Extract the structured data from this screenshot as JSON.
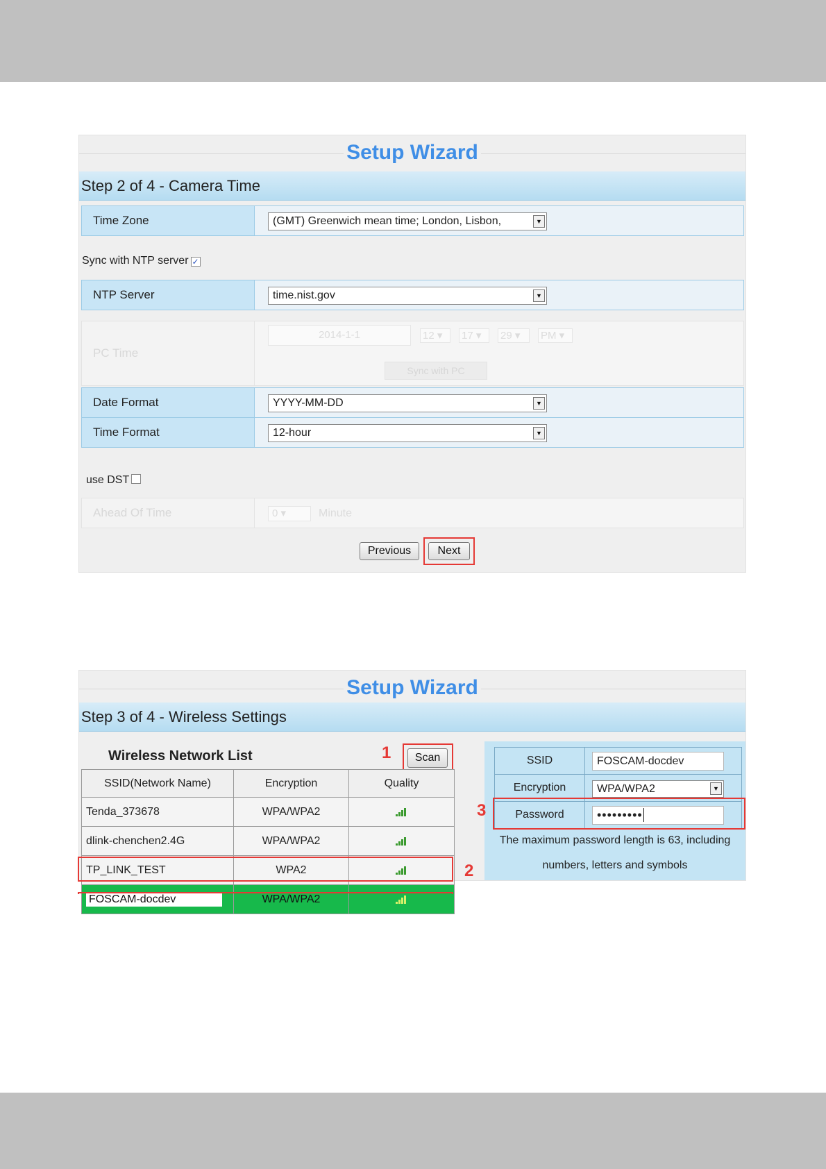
{
  "wizard_title": "Setup Wizard",
  "step2": {
    "header": "Step 2 of 4 - Camera Time",
    "time_zone": {
      "label": "Time Zone",
      "value": "(GMT) Greenwich mean time; London, Lisbon,"
    },
    "sync_ntp_label": "Sync with NTP server",
    "sync_ntp_checked": true,
    "ntp_server": {
      "label": "NTP Server",
      "value": "time.nist.gov"
    },
    "pc_time": {
      "label": "PC Time",
      "date": "2014-1-1",
      "hour": "12",
      "minute": "17",
      "second": "29",
      "ampm": "PM",
      "sync_button": "Sync with PC"
    },
    "date_format": {
      "label": "Date Format",
      "value": "YYYY-MM-DD"
    },
    "time_format": {
      "label": "Time Format",
      "value": "12-hour"
    },
    "use_dst_label": "use DST",
    "use_dst_checked": false,
    "ahead_of_time": {
      "label": "Ahead Of Time",
      "value": "0",
      "unit": "Minute"
    },
    "previous_button": "Previous",
    "next_button": "Next"
  },
  "step3": {
    "header": "Step 3 of 4 - Wireless Settings",
    "list_title": "Wireless Network List",
    "scan_button": "Scan",
    "columns": [
      "SSID(Network Name)",
      "Encryption",
      "Quality"
    ],
    "networks": [
      {
        "ssid": "Tenda_373678",
        "encryption": "WPA/WPA2"
      },
      {
        "ssid": "dlink-chenchen2.4G",
        "encryption": "WPA/WPA2"
      },
      {
        "ssid": "TP_LINK_TEST",
        "encryption": "WPA2"
      },
      {
        "ssid": "FOSCAM-docdev",
        "encryption": "WPA/WPA2"
      }
    ],
    "form": {
      "ssid_label": "SSID",
      "ssid_value": "FOSCAM-docdev",
      "encryption_label": "Encryption",
      "encryption_value": "WPA/WPA2",
      "password_label": "Password",
      "password_value": "•••••••••"
    },
    "note_line1": "The maximum password length is 63, including",
    "note_line2": "numbers, letters and symbols"
  },
  "callouts": [
    "1",
    "2",
    "3"
  ],
  "colors": {
    "title_blue": "#3f8ee6",
    "highlight_red": "#e53935",
    "selected_green": "#17b94b"
  }
}
